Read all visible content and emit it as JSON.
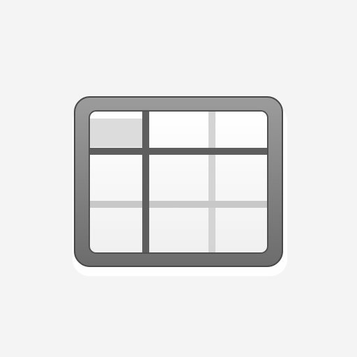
{
  "icon": {
    "name": "spreadsheet-table-icon",
    "colors": {
      "background": "#f4f4f4",
      "frame_top": "#9a9a9a",
      "frame_bottom": "#6f6f6f",
      "frame_outline": "#454545",
      "cell_fill": "#ffffff",
      "cell_fill_shade": "#f1f1f1",
      "header_cell": "#dedede",
      "grid_dark": "#5f5f5f",
      "grid_light": "#c8c8c8",
      "grid_lighter": "#d6d6d6"
    }
  }
}
